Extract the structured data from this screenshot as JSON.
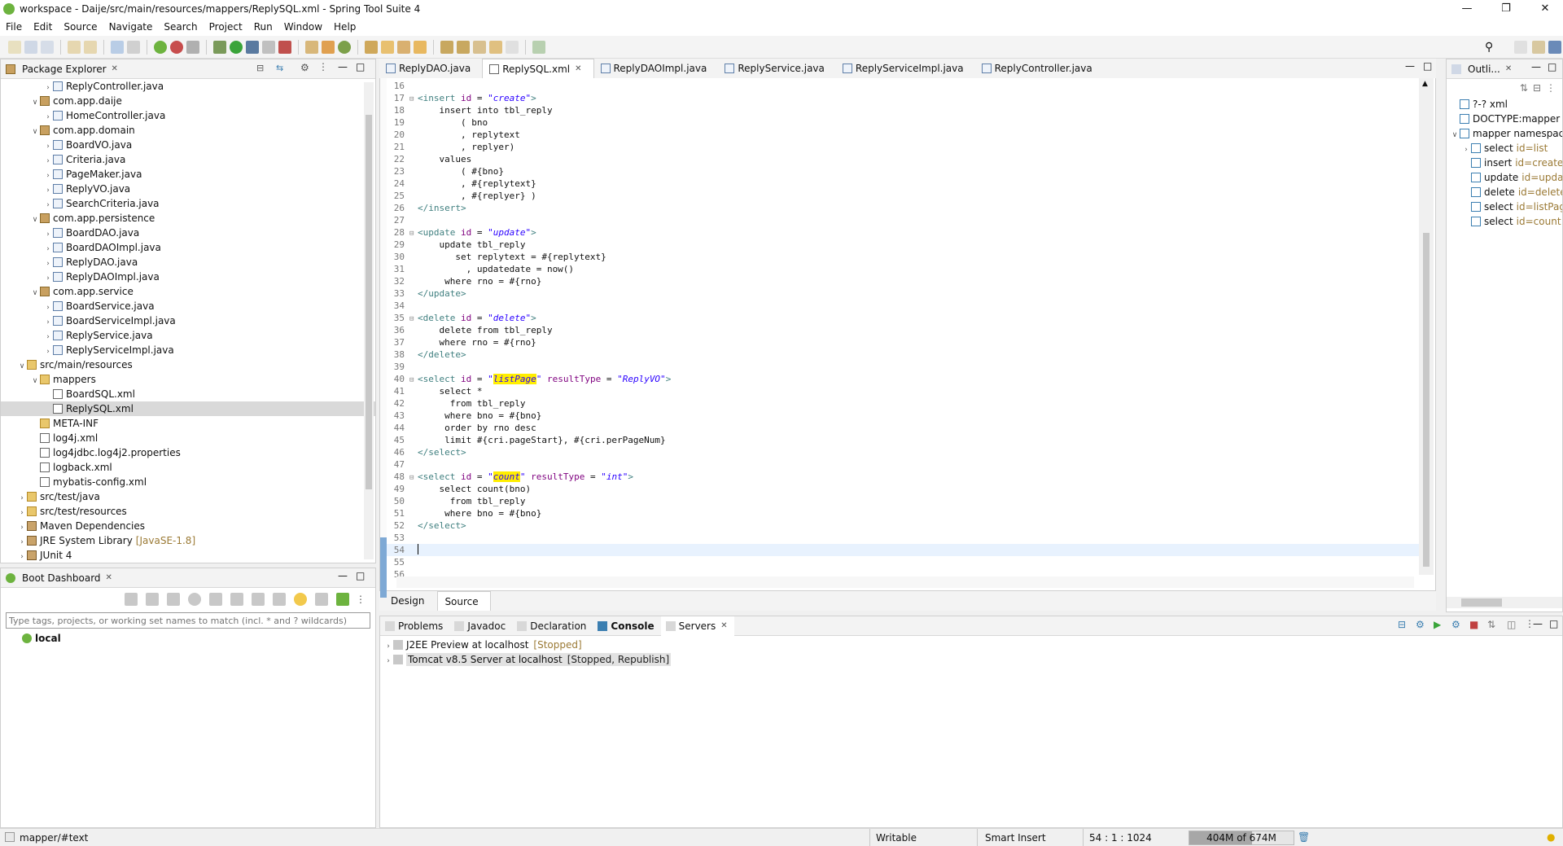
{
  "window": {
    "title": "workspace - Daije/src/main/resources/mappers/ReplySQL.xml - Spring Tool Suite 4"
  },
  "menu": [
    "File",
    "Edit",
    "Source",
    "Navigate",
    "Search",
    "Project",
    "Run",
    "Window",
    "Help"
  ],
  "package_explorer": {
    "title": "Package Explorer",
    "items": [
      {
        "label": "ReplyController.java",
        "depth": 3,
        "icon": "java"
      },
      {
        "label": "com.app.daije",
        "depth": 2,
        "icon": "pkg",
        "open": true
      },
      {
        "label": "HomeController.java",
        "depth": 3,
        "icon": "java"
      },
      {
        "label": "com.app.domain",
        "depth": 2,
        "icon": "pkg",
        "open": true
      },
      {
        "label": "BoardVO.java",
        "depth": 3,
        "icon": "java"
      },
      {
        "label": "Criteria.java",
        "depth": 3,
        "icon": "java"
      },
      {
        "label": "PageMaker.java",
        "depth": 3,
        "icon": "java"
      },
      {
        "label": "ReplyVO.java",
        "depth": 3,
        "icon": "java"
      },
      {
        "label": "SearchCriteria.java",
        "depth": 3,
        "icon": "java"
      },
      {
        "label": "com.app.persistence",
        "depth": 2,
        "icon": "pkg",
        "open": true
      },
      {
        "label": "BoardDAO.java",
        "depth": 3,
        "icon": "java"
      },
      {
        "label": "BoardDAOImpl.java",
        "depth": 3,
        "icon": "java"
      },
      {
        "label": "ReplyDAO.java",
        "depth": 3,
        "icon": "java"
      },
      {
        "label": "ReplyDAOImpl.java",
        "depth": 3,
        "icon": "java"
      },
      {
        "label": "com.app.service",
        "depth": 2,
        "icon": "pkg",
        "open": true
      },
      {
        "label": "BoardService.java",
        "depth": 3,
        "icon": "java"
      },
      {
        "label": "BoardServiceImpl.java",
        "depth": 3,
        "icon": "java"
      },
      {
        "label": "ReplyService.java",
        "depth": 3,
        "icon": "java"
      },
      {
        "label": "ReplyServiceImpl.java",
        "depth": 3,
        "icon": "java"
      },
      {
        "label": "src/main/resources",
        "depth": 1,
        "icon": "folder",
        "open": true
      },
      {
        "label": "mappers",
        "depth": 2,
        "icon": "folder",
        "open": true
      },
      {
        "label": "BoardSQL.xml",
        "depth": 3,
        "icon": "xml",
        "leaf": true
      },
      {
        "label": "ReplySQL.xml",
        "depth": 3,
        "icon": "xml",
        "leaf": true,
        "selected": true
      },
      {
        "label": "META-INF",
        "depth": 2,
        "icon": "folder",
        "leaf": true
      },
      {
        "label": "log4j.xml",
        "depth": 2,
        "icon": "xml",
        "leaf": true
      },
      {
        "label": "log4jdbc.log4j2.properties",
        "depth": 2,
        "icon": "xml",
        "leaf": true
      },
      {
        "label": "logback.xml",
        "depth": 2,
        "icon": "xml",
        "leaf": true
      },
      {
        "label": "mybatis-config.xml",
        "depth": 2,
        "icon": "xml",
        "leaf": true
      },
      {
        "label": "src/test/java",
        "depth": 1,
        "icon": "folder"
      },
      {
        "label": "src/test/resources",
        "depth": 1,
        "icon": "folder"
      },
      {
        "label": "Maven Dependencies",
        "depth": 1,
        "icon": "lib"
      },
      {
        "label": "JRE System Library",
        "depth": 1,
        "icon": "lib",
        "deco": "[JavaSE-1.8]"
      },
      {
        "label": "JUnit 4",
        "depth": 1,
        "icon": "lib"
      }
    ]
  },
  "boot_dashboard": {
    "title": "Boot Dashboard",
    "filter_placeholder": "Type tags, projects, or working set names to match (incl. * and ? wildcards)",
    "local_label": "local"
  },
  "editor": {
    "tabs": [
      {
        "label": "ReplyDAO.java"
      },
      {
        "label": "ReplySQL.xml",
        "active": true
      },
      {
        "label": "ReplyDAOImpl.java"
      },
      {
        "label": "ReplyService.java"
      },
      {
        "label": "ReplyServiceImpl.java"
      },
      {
        "label": "ReplyController.java"
      }
    ],
    "bottom_tabs": [
      "Design",
      "Source"
    ],
    "lines": [
      {
        "n": "16",
        "html": ""
      },
      {
        "n": "17",
        "fold": true,
        "html": "<span class='tag'>&lt;insert</span> <span class='at'>id</span> = <span class='val'>\"create\"</span><span class='tag'>&gt;</span>"
      },
      {
        "n": "18",
        "html": "    insert into tbl_reply"
      },
      {
        "n": "19",
        "html": "        ( bno"
      },
      {
        "n": "20",
        "html": "        , replytext"
      },
      {
        "n": "21",
        "html": "        , replyer)"
      },
      {
        "n": "22",
        "html": "    values"
      },
      {
        "n": "23",
        "html": "        ( #{bno}"
      },
      {
        "n": "24",
        "html": "        , #{replytext}"
      },
      {
        "n": "25",
        "html": "        , #{replyer} )"
      },
      {
        "n": "26",
        "html": "<span class='tag'>&lt;/insert&gt;</span>"
      },
      {
        "n": "27",
        "html": ""
      },
      {
        "n": "28",
        "fold": true,
        "html": "<span class='tag'>&lt;update</span> <span class='at'>id</span> = <span class='val'>\"update\"</span><span class='tag'>&gt;</span>"
      },
      {
        "n": "29",
        "html": "    update tbl_reply"
      },
      {
        "n": "30",
        "html": "       set replytext = #{replytext}"
      },
      {
        "n": "31",
        "html": "         , updatedate = now()"
      },
      {
        "n": "32",
        "html": "     where rno = #{rno}"
      },
      {
        "n": "33",
        "html": "<span class='tag'>&lt;/update&gt;</span>"
      },
      {
        "n": "34",
        "html": ""
      },
      {
        "n": "35",
        "fold": true,
        "html": "<span class='tag'>&lt;delete</span> <span class='at'>id</span> = <span class='val'>\"delete\"</span><span class='tag'>&gt;</span>"
      },
      {
        "n": "36",
        "html": "    delete from tbl_reply"
      },
      {
        "n": "37",
        "html": "    where rno = #{rno}"
      },
      {
        "n": "38",
        "html": "<span class='tag'>&lt;/delete&gt;</span>"
      },
      {
        "n": "39",
        "html": ""
      },
      {
        "n": "40",
        "fold": true,
        "html": "<span class='tag'>&lt;select</span> <span class='at'>id</span> = <span class='val'>\"</span><span class='hl'>listPage</span><span class='val'>\"</span> <span class='at'>resultType</span> = <span class='val'>\"ReplyVO\"</span><span class='tag'>&gt;</span>"
      },
      {
        "n": "41",
        "html": "    select *"
      },
      {
        "n": "42",
        "html": "      from tbl_reply"
      },
      {
        "n": "43",
        "html": "     where bno = #{bno}"
      },
      {
        "n": "44",
        "html": "     order by rno desc"
      },
      {
        "n": "45",
        "html": "     limit #{cri.pageStart}, #{cri.perPageNum}"
      },
      {
        "n": "46",
        "html": "<span class='tag'>&lt;/select&gt;</span>"
      },
      {
        "n": "47",
        "html": ""
      },
      {
        "n": "48",
        "fold": true,
        "html": "<span class='tag'>&lt;select</span> <span class='at'>id</span> = <span class='val'>\"</span><span class='hl'>count</span><span class='val'>\"</span> <span class='at'>resultType</span> = <span class='val'>\"int\"</span><span class='tag'>&gt;</span>"
      },
      {
        "n": "49",
        "html": "    select count(bno)"
      },
      {
        "n": "50",
        "html": "      from tbl_reply"
      },
      {
        "n": "51",
        "html": "     where bno = #{bno}"
      },
      {
        "n": "52",
        "html": "<span class='tag'>&lt;/select&gt;</span>"
      },
      {
        "n": "53",
        "html": ""
      },
      {
        "n": "54",
        "html": "",
        "current": true
      },
      {
        "n": "55",
        "html": ""
      },
      {
        "n": "56",
        "html": ""
      }
    ]
  },
  "outline": {
    "title": "Outli...",
    "items": [
      {
        "label": "?-? xml",
        "depth": 0
      },
      {
        "label": "DOCTYPE:mapper",
        "depth": 0
      },
      {
        "label": "mapper namespace",
        "depth": 0,
        "open": true
      },
      {
        "label": "select",
        "attr": "id=list",
        "depth": 1,
        "twisty": true
      },
      {
        "label": "insert",
        "attr": "id=create",
        "depth": 1
      },
      {
        "label": "update",
        "attr": "id=upda",
        "depth": 1
      },
      {
        "label": "delete",
        "attr": "id=delete",
        "depth": 1
      },
      {
        "label": "select",
        "attr": "id=listPag",
        "depth": 1
      },
      {
        "label": "select",
        "attr": "id=count",
        "depth": 1
      }
    ]
  },
  "bottom_panel": {
    "tabs": [
      "Problems",
      "Javadoc",
      "Declaration",
      "Console",
      "Servers"
    ],
    "servers": [
      {
        "label": "J2EE Preview at localhost",
        "status": "[Stopped]"
      },
      {
        "label": "Tomcat v8.5 Server at localhost",
        "status": "[Stopped, Republish]"
      }
    ]
  },
  "status": {
    "path": "mapper/#text",
    "writable": "Writable",
    "insert_mode": "Smart Insert",
    "position": "54 : 1 : 1024",
    "heap": "404M of 674M",
    "heap_fraction": 0.6
  },
  "colors": {
    "accent": "#3c7fb1",
    "tag": "#3f7f7f",
    "attr": "#7f007f",
    "value": "#2a00ff",
    "highlight": "#ffee00"
  }
}
